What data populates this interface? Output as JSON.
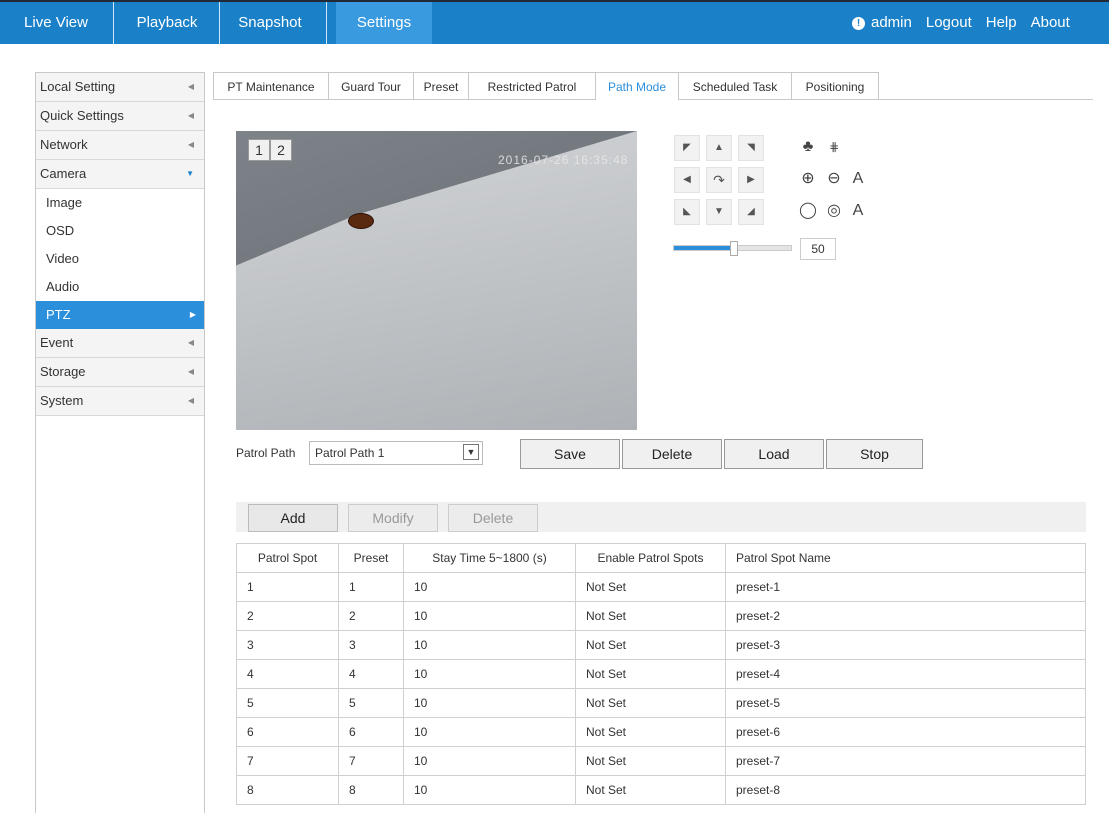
{
  "nav": {
    "items": [
      "Live View",
      "Playback",
      "Snapshot",
      "Settings"
    ],
    "active": "Settings",
    "user": "admin",
    "logout": "Logout",
    "help": "Help",
    "about": "About"
  },
  "sidebar": {
    "items": [
      {
        "label": "Local Setting"
      },
      {
        "label": "Quick Settings"
      },
      {
        "label": "Network"
      },
      {
        "label": "Camera"
      },
      {
        "label": "Event"
      },
      {
        "label": "Storage"
      },
      {
        "label": "System"
      }
    ],
    "camera_sub": [
      "Image",
      "OSD",
      "Video",
      "Audio",
      "PTZ"
    ],
    "active_sub": "PTZ"
  },
  "tabs": [
    "PT Maintenance",
    "Guard Tour",
    "Preset",
    "Restricted Patrol",
    "Path Mode",
    "Scheduled Task",
    "Positioning"
  ],
  "active_tab": "Path Mode",
  "video": {
    "window_labels": [
      "1",
      "2"
    ],
    "timestamp": "2016-07-26 16:35:48"
  },
  "ptz": {
    "speed_value": "50",
    "speed_fraction": 0.5
  },
  "patrol": {
    "label": "Patrol Path",
    "selected": "Patrol Path 1",
    "save": "Save",
    "delete": "Delete",
    "load": "Load",
    "stop": "Stop"
  },
  "toolbar": {
    "add": "Add",
    "modify": "Modify",
    "delete": "Delete"
  },
  "table": {
    "headers": [
      "Patrol Spot",
      "Preset",
      "Stay Time 5~1800 (s)",
      "Enable Patrol Spots",
      "Patrol Spot Name"
    ],
    "rows": [
      [
        "1",
        "1",
        "10",
        "Not Set",
        "preset-1"
      ],
      [
        "2",
        "2",
        "10",
        "Not Set",
        "preset-2"
      ],
      [
        "3",
        "3",
        "10",
        "Not Set",
        "preset-3"
      ],
      [
        "4",
        "4",
        "10",
        "Not Set",
        "preset-4"
      ],
      [
        "5",
        "5",
        "10",
        "Not Set",
        "preset-5"
      ],
      [
        "6",
        "6",
        "10",
        "Not Set",
        "preset-6"
      ],
      [
        "7",
        "7",
        "10",
        "Not Set",
        "preset-7"
      ],
      [
        "8",
        "8",
        "10",
        "Not Set",
        "preset-8"
      ]
    ]
  },
  "colors": {
    "topbar": "#1a80c8",
    "active_nav": "#3a9ae0",
    "accent": "#2c8fdb"
  }
}
